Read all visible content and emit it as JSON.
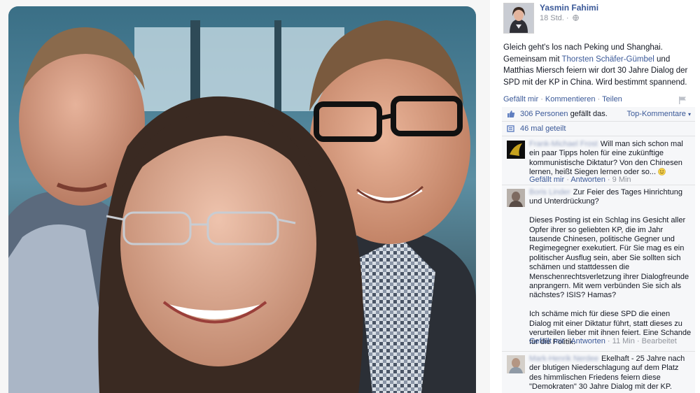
{
  "post": {
    "author": "Yasmin Fahimi",
    "time": "18 Std.",
    "privacy_icon": "globe-icon",
    "text_before_link": "Gleich geht's los nach Peking und Shanghai. Gemeinsam mit ",
    "tagged_person": "Thorsten Schäfer-Gümbel",
    "text_after_link": " und Matthias Miersch feiern wir dort 30 Jahre Dialog der SPD mit der KP in China. Wird bestimmt spannend.",
    "actions": {
      "like": "Gefällt mir",
      "comment": "Kommentieren",
      "share": "Teilen",
      "separator": "·"
    }
  },
  "reactions": {
    "count_label": "306 Personen",
    "suffix": "gefällt das.",
    "sort_label": "Top-Kommentare",
    "shares": "46 mal geteilt"
  },
  "comments": [
    {
      "author": "Frank-Michael Frost",
      "paragraphs": [
        "Will man sich schon mal ein paar Tipps holen für eine zukünftige kommunistische Diktatur? Von den Chinesen lernen, heißt Siegen lernen oder so..."
      ],
      "emoji": "smile-emoji",
      "like": "Gefällt mir",
      "reply": "Antworten",
      "time": "9 Min",
      "edited": ""
    },
    {
      "author": "Boris Linder",
      "paragraphs": [
        "Zur Feier des Tages Hinrichtung und Unterdrückung?",
        "Dieses Posting ist ein Schlag ins Gesicht aller Opfer ihrer so geliebten KP, die im Jahr tausende Chinesen, politische Gegner und Regimegegner exekutiert. Für Sie mag es ein politischer Ausflug sein, aber Sie sollten sich schämen und stattdessen die Menschenrechtsverletzung ihrer Dialogfreunde anprangern. Mit wem verbünden Sie sich als nächstes? ISIS? Hamas?",
        "Ich schäme mich für diese SPD die einen Dialog mit einer Diktatur führt, statt dieses zu verurteilen lieber mit ihnen feiert. Eine Schande für die Politik."
      ],
      "like": "Gefällt mir",
      "reply": "Antworten",
      "time": "11 Min",
      "edited": "Bearbeitet"
    },
    {
      "author": "Mark-Henrik Nerdee",
      "paragraphs": [
        "Ekelhaft - 25 Jahre nach der blutigen Niederschlagung auf dem Platz des himmlischen Friedens feiern diese \"Demokraten\" 30 Jahre Dialog mit der KP. Sowas ist beschämend für die ehemals große und stolze"
      ]
    }
  ],
  "colors": {
    "link": "#3b5998",
    "meta": "#90949c",
    "panel": "#f6f7f9",
    "text": "#141823"
  }
}
